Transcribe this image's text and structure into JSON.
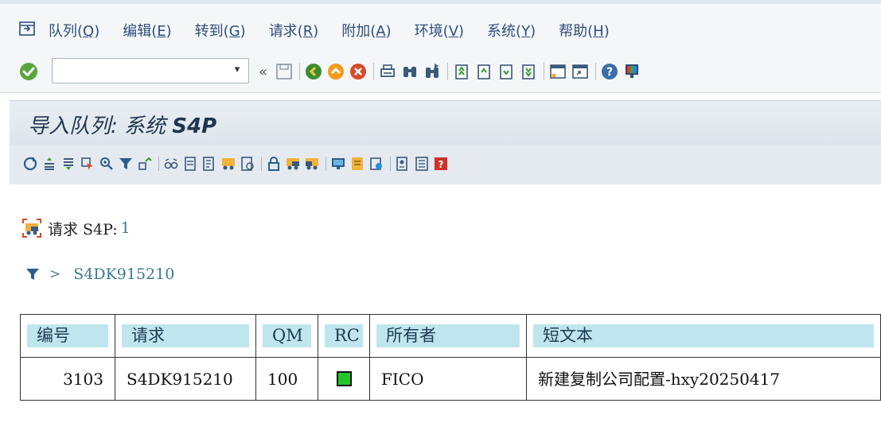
{
  "menu": {
    "items": [
      {
        "text": "队列(",
        "key": "Q",
        "tail": ")"
      },
      {
        "text": "编辑(",
        "key": "E",
        "tail": ")"
      },
      {
        "text": "转到(",
        "key": "G",
        "tail": ")"
      },
      {
        "text": "请求(",
        "key": "R",
        "tail": ")"
      },
      {
        "text": "附加(",
        "key": "A",
        "tail": ")"
      },
      {
        "text": "环境(",
        "key": "V",
        "tail": ")"
      },
      {
        "text": "系统(",
        "key": "Y",
        "tail": ")"
      },
      {
        "text": "帮助(",
        "key": "H",
        "tail": ")"
      }
    ]
  },
  "toolbar": {
    "command_value": "",
    "dropdown_glyph": "▾",
    "collapse_glyph": "«"
  },
  "title": {
    "prefix": "导入队列: 系统 ",
    "system": "S4P"
  },
  "request": {
    "label": "请求 S4P:",
    "count": "1"
  },
  "filter": {
    "chevron": ">",
    "value": "S4DK915210"
  },
  "table": {
    "headers": [
      "编号",
      "请求",
      "QM",
      "RC",
      "所有者",
      "短文本"
    ],
    "rows": [
      {
        "number": "3103",
        "request": "S4DK915210",
        "qm": "100",
        "rc_status": "green",
        "owner": "FICO",
        "short_text": "新建复制公司配置-hxy20250417"
      }
    ]
  },
  "colors": {
    "accent": "#2e4e7c",
    "rc_green": "#22c82b",
    "header_cell": "#bfe6ee"
  }
}
